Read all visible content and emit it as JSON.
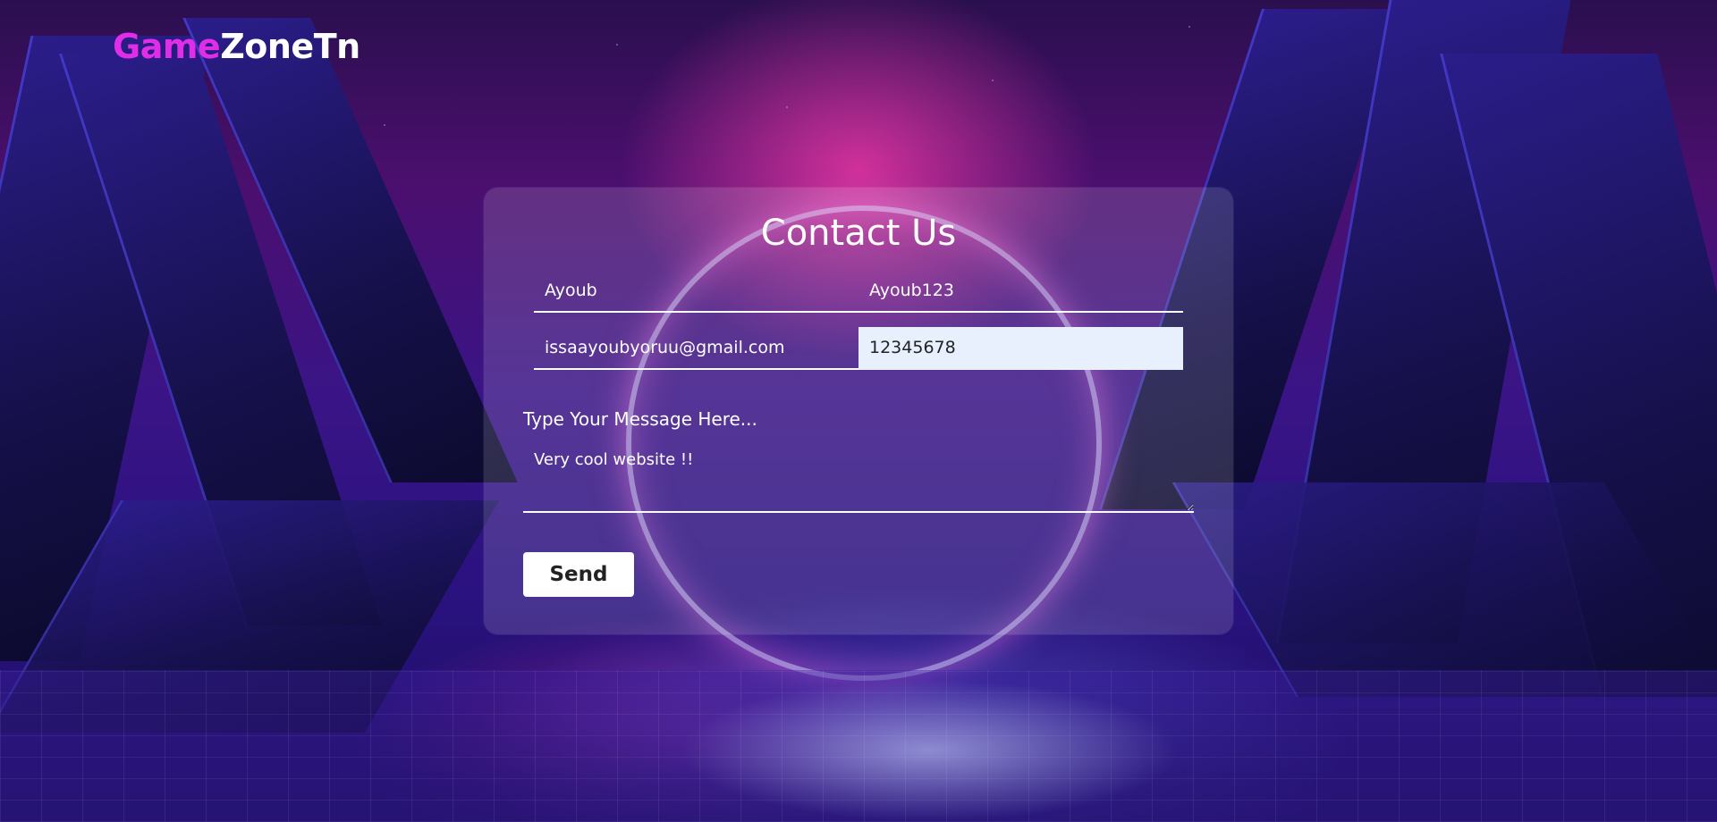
{
  "brand": {
    "part1": "Game",
    "part2": "ZoneTn"
  },
  "contact_form": {
    "title": "Contact Us",
    "name_value": "Ayoub",
    "username_value": "Ayoub123",
    "email_value": "issaayoubyoruu@gmail.com",
    "phone_value": "12345678",
    "message_label": "Type Your Message Here...",
    "message_value": "Very cool website !!",
    "send_label": "Send"
  },
  "colors": {
    "brand_accent": "#e02ee8",
    "autofill_bg": "#e8f0fe"
  }
}
